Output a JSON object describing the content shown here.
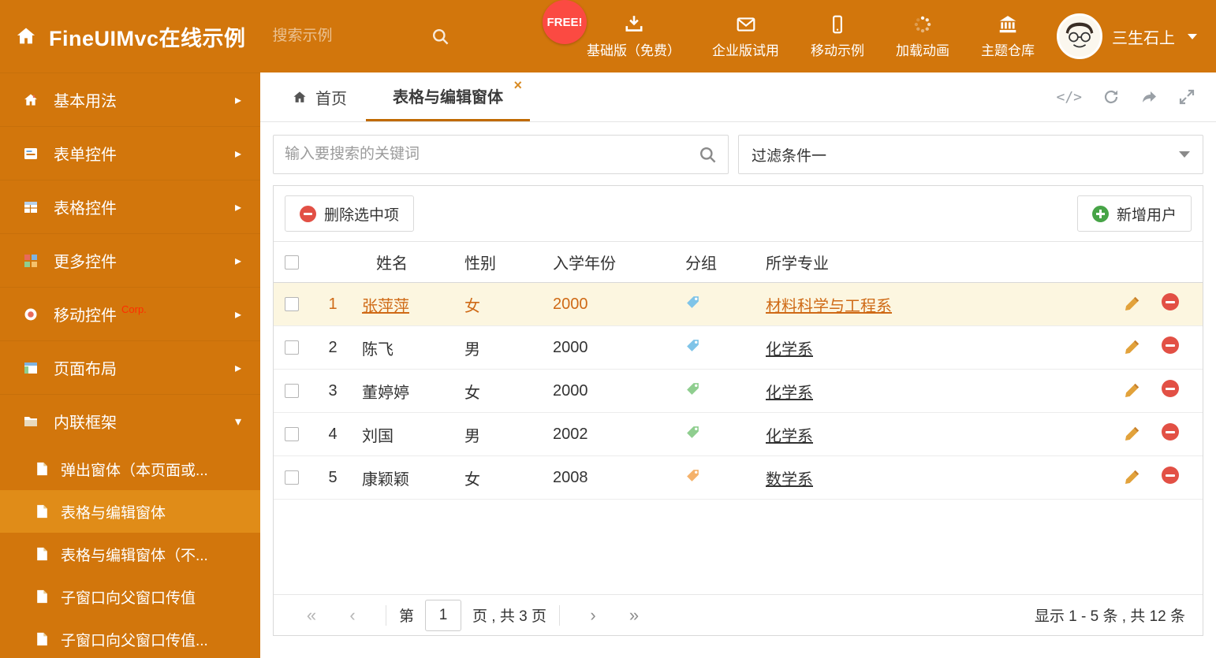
{
  "colors": {
    "accent": "#d2760c",
    "link": "#cf6a16",
    "red": "#e25045",
    "green": "#47a447",
    "active_sub": "#e08c18"
  },
  "header": {
    "app_title": "FineUIMvc在线示例",
    "search_placeholder": "搜索示例",
    "free_badge": "FREE!",
    "nav": [
      {
        "label": "基础版（免费）"
      },
      {
        "label": "企业版试用"
      },
      {
        "label": "移动示例"
      },
      {
        "label": "加载动画"
      },
      {
        "label": "主题仓库"
      }
    ],
    "user_name": "三生石上"
  },
  "sidebar": {
    "items": [
      {
        "label": "基本用法"
      },
      {
        "label": "表单控件"
      },
      {
        "label": "表格控件"
      },
      {
        "label": "更多控件"
      },
      {
        "label": "移动控件",
        "badge": "Corp."
      },
      {
        "label": "页面布局"
      },
      {
        "label": "内联框架"
      }
    ],
    "subitems": [
      {
        "label": "弹出窗体（本页面或..."
      },
      {
        "label": "表格与编辑窗体"
      },
      {
        "label": "表格与编辑窗体（不..."
      },
      {
        "label": "子窗口向父窗口传值"
      },
      {
        "label": "子窗口向父窗口传值..."
      }
    ]
  },
  "tabs": {
    "home": "首页",
    "active": "表格与编辑窗体"
  },
  "search": {
    "placeholder": "输入要搜索的关键词"
  },
  "filter": {
    "value": "过滤条件一"
  },
  "toolbar": {
    "delete_label": "删除选中项",
    "add_label": "新增用户"
  },
  "table": {
    "columns": [
      "姓名",
      "性别",
      "入学年份",
      "分组",
      "所学专业"
    ],
    "rows": [
      {
        "num": "1",
        "name": "张萍萍",
        "gender": "女",
        "year": "2000",
        "tag": "blue",
        "major": "材料科学与工程系"
      },
      {
        "num": "2",
        "name": "陈飞",
        "gender": "男",
        "year": "2000",
        "tag": "blue",
        "major": "化学系"
      },
      {
        "num": "3",
        "name": "董婷婷",
        "gender": "女",
        "year": "2000",
        "tag": "green",
        "major": "化学系"
      },
      {
        "num": "4",
        "name": "刘国",
        "gender": "男",
        "year": "2002",
        "tag": "green",
        "major": "化学系"
      },
      {
        "num": "5",
        "name": "康颖颖",
        "gender": "女",
        "year": "2008",
        "tag": "orange",
        "major": "数学系"
      }
    ]
  },
  "pagination": {
    "prefix": "第",
    "page": "1",
    "suffix": "页 , 共 3 页",
    "summary": "显示 1 - 5 条 , 共 12 条"
  }
}
